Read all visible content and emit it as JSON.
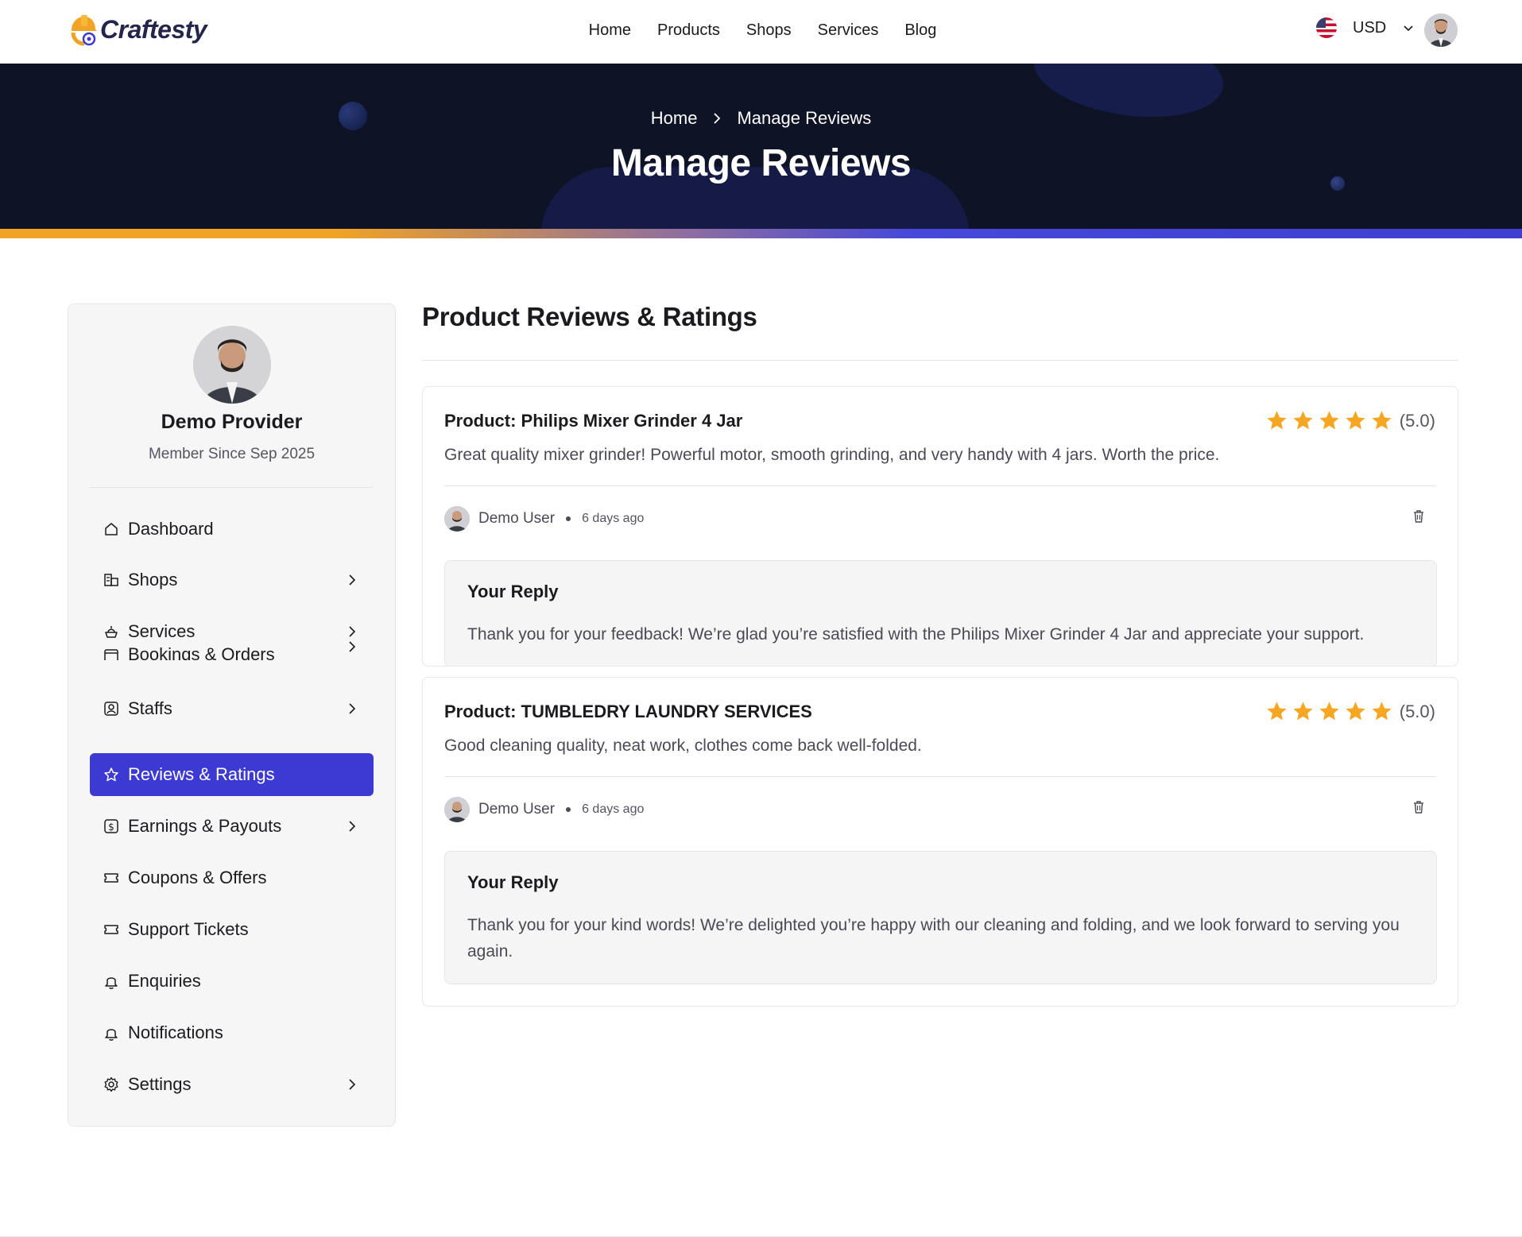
{
  "header": {
    "logo_text": "Craftesty",
    "nav": [
      "Home",
      "Products",
      "Shops",
      "Services",
      "Blog"
    ],
    "currency": "USD"
  },
  "banner": {
    "breadcrumb": [
      "Home",
      "Manage Reviews"
    ],
    "title": "Manage Reviews"
  },
  "sidebar": {
    "profile_name": "Demo Provider",
    "member_since": "Member Since Sep 2025",
    "items": [
      {
        "label": "Dashboard",
        "icon": "home-icon"
      },
      {
        "label": "Shops",
        "icon": "shop-icon"
      },
      {
        "label": "Services",
        "icon": "services-icon"
      },
      {
        "label": "Bookings & Orders",
        "icon": "calendar-icon"
      },
      {
        "label": "Staffs",
        "icon": "staff-icon"
      },
      {
        "label": "Reviews & Ratings",
        "icon": "star-icon",
        "active": true
      },
      {
        "label": "Earnings & Payouts",
        "icon": "dollar-icon"
      },
      {
        "label": "Coupons & Offers",
        "icon": "ticket-icon"
      },
      {
        "label": "Support Tickets",
        "icon": "ticket-icon"
      },
      {
        "label": "Enquiries",
        "icon": "bell-icon"
      },
      {
        "label": "Notifications",
        "icon": "bell-icon"
      },
      {
        "label": "Settings",
        "icon": "gear-icon"
      }
    ]
  },
  "main": {
    "section_title": "Product Reviews & Ratings",
    "reviews": [
      {
        "product": "Product: Philips Mixer Grinder 4 Jar",
        "rating": 5,
        "score": "(5.0)",
        "text": "Great quality mixer grinder! Powerful motor, smooth grinding, and very handy with 4 jars. Worth the price.",
        "user": "Demo User",
        "time": "6 days ago",
        "reply_title": "Your Reply",
        "reply_text": "Thank you for your feedback! We’re glad you’re satisfied with the Philips Mixer Grinder 4 Jar and appreciate your support."
      },
      {
        "product": "Product: TUMBLEDRY LAUNDRY SERVICES",
        "rating": 5,
        "score": "(5.0)",
        "text": "Good cleaning quality, neat work, clothes come back well-folded.",
        "user": "Demo User",
        "time": "6 days ago",
        "reply_title": "Your Reply",
        "reply_text": "Thank you for your kind words! We’re delighted you’re happy with our cleaning and folding, and we look forward to serving you again."
      }
    ]
  },
  "colors": {
    "accent": "#3d3ad4",
    "banner_bg": "#0e1326",
    "star": "#f5a623",
    "brand_orange": "#f0a324"
  }
}
